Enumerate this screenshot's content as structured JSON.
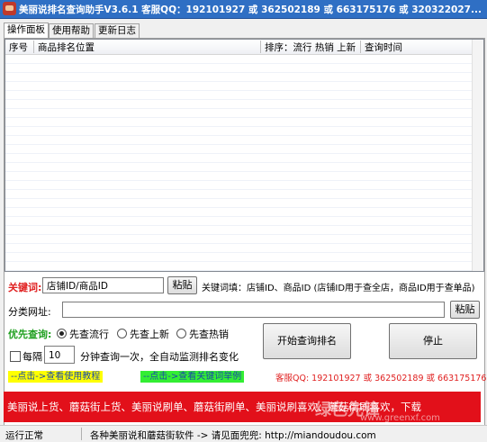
{
  "window": {
    "title": "美丽说排名查询助手V3.6.1 客服QQ：192101927 或 362502189 或 663175176 或 320322027..."
  },
  "tabs": [
    {
      "label": "操作面板"
    },
    {
      "label": "使用帮助"
    },
    {
      "label": "更新日志"
    }
  ],
  "table": {
    "columns": [
      "序号",
      "商品排名位置",
      "排序：流行 热销 上新",
      "查询时间"
    ],
    "rows": []
  },
  "form": {
    "keyword_label": "关键词:",
    "keyword_value": "店铺ID/商品ID",
    "paste_label": "粘贴",
    "keyword_hint": "关键词填：店铺ID、商品ID (店铺ID用于查全店，商品ID用于查单品)",
    "category_label": "分类网址:",
    "category_value": "",
    "paste2_label": "粘贴",
    "priority_label": "优先查询:",
    "radios": [
      {
        "label": "先查流行",
        "checked": true
      },
      {
        "label": "先查上新",
        "checked": false
      },
      {
        "label": "先查热销",
        "checked": false
      }
    ],
    "interval_check_label": "每隔",
    "interval_value": "10",
    "interval_suffix": "分钟查询一次，全自动监测排名变化",
    "start_button": "开始查询排名",
    "stop_button": "停止"
  },
  "links": {
    "tutorial": "--点击->查看使用教程",
    "keyword_example": "--点击->查看关键词举例",
    "support_qq": "客服QQ: 192101927 或 362502189 或 663175176 !"
  },
  "banner": {
    "text": "美丽说上货、蘑菇街上货、美丽说刷单、蘑菇街刷单、美丽说刷喜欢、蘑菇街刷喜欢，下载"
  },
  "watermark": {
    "text": "绿色先锋",
    "url": "www.greenxf.com"
  },
  "status": {
    "state": "运行正常",
    "message": "各种美丽说和蘑菇街软件 -> 请见面兜兜: http://miandoudou.com"
  },
  "colors": {
    "titlebar": "#2f6fc4",
    "banner": "#e2101a",
    "label_red": "#e02020",
    "label_green": "#20a020"
  }
}
